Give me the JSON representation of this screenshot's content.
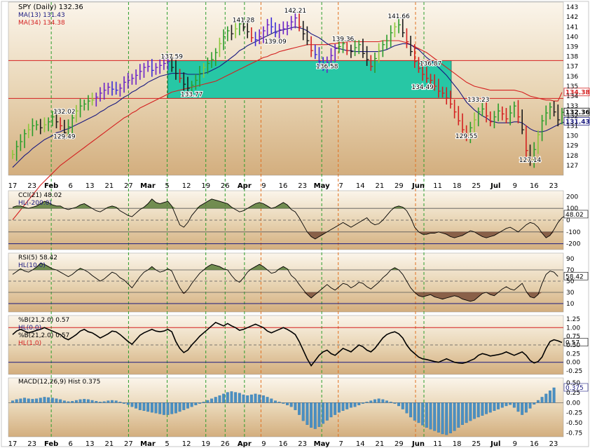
{
  "chart_data": {
    "type": "line",
    "dates": [
      "17",
      "23",
      "Feb",
      "6",
      "13",
      "21",
      "27",
      "Mar",
      "5",
      "12",
      "19",
      "26",
      "Apr",
      "9",
      "16",
      "23",
      "May",
      "7",
      "14",
      "21",
      "29",
      "Jun",
      "11",
      "18",
      "25",
      "Jul",
      "9",
      "16",
      "23"
    ],
    "main": {
      "title": "SPY (Daily) 132.36",
      "legend": [
        {
          "label": "MA(13) 131.43",
          "color": "#1a1a80"
        },
        {
          "label": "MA(34) 134.38",
          "color": "#d42020"
        }
      ],
      "yticks": [
        127,
        128,
        129,
        130,
        131,
        132,
        133,
        134,
        135,
        136,
        137,
        138,
        139,
        140,
        141,
        142,
        143
      ],
      "ylim": [
        126,
        143.5
      ],
      "annotations": [
        {
          "text": "132.02",
          "x": 13,
          "y": 132.02
        },
        {
          "text": "129.49",
          "x": 13,
          "y": 129.49
        },
        {
          "text": "137.59",
          "x": 40,
          "y": 137.59
        },
        {
          "text": "133.77",
          "x": 45,
          "y": 133.77
        },
        {
          "text": "141.28",
          "x": 58,
          "y": 141.28
        },
        {
          "text": "139.09",
          "x": 66,
          "y": 139.09
        },
        {
          "text": "142.21",
          "x": 71,
          "y": 142.21
        },
        {
          "text": "139.36",
          "x": 83,
          "y": 139.36
        },
        {
          "text": "136.58",
          "x": 79,
          "y": 136.58
        },
        {
          "text": "141.66",
          "x": 97,
          "y": 141.66
        },
        {
          "text": "136.87",
          "x": 105,
          "y": 136.87
        },
        {
          "text": "134.49",
          "x": 103,
          "y": 134.49
        },
        {
          "text": "133.23",
          "x": 117,
          "y": 133.23
        },
        {
          "text": "129.55",
          "x": 114,
          "y": 129.55
        },
        {
          "text": "127.14",
          "x": 130,
          "y": 127.14
        }
      ],
      "price_labels": [
        {
          "text": "134.38",
          "y": 134.38,
          "color": "#d42020"
        },
        {
          "text": "132.36",
          "y": 132.36,
          "color": "#000000"
        },
        {
          "text": "131.43",
          "y": 131.43,
          "color": "#1a1a80"
        }
      ],
      "zone": [
        133.77,
        137.59
      ],
      "closes": [
        128.1,
        128.9,
        129.4,
        130.2,
        130.6,
        131.0,
        131.1,
        130.8,
        131.1,
        131.4,
        131.9,
        131.4,
        131.0,
        130.3,
        130.9,
        131.8,
        132.5,
        133.0,
        133.2,
        133.5,
        133.6,
        133.9,
        134.3,
        134.6,
        134.9,
        134.7,
        134.6,
        134.8,
        135.4,
        135.6,
        135.8,
        136.1,
        136.5,
        136.9,
        137.0,
        136.6,
        136.9,
        137.1,
        137.3,
        137.5,
        136.9,
        136.3,
        135.8,
        135.2,
        134.8,
        135.1,
        135.6,
        136.3,
        136.9,
        137.3,
        137.7,
        138.4,
        139.3,
        140.0,
        140.6,
        140.3,
        140.8,
        141.3,
        141.0,
        140.5,
        139.9,
        139.7,
        140.0,
        140.6,
        141.2,
        141.0,
        140.4,
        140.7,
        140.8,
        141.1,
        141.5,
        141.9,
        141.0,
        140.3,
        139.6,
        138.6,
        138.2,
        137.5,
        137.0,
        137.4,
        138.1,
        138.8,
        139.0,
        139.3,
        138.6,
        138.5,
        138.9,
        139.2,
        138.3,
        137.7,
        137.0,
        137.8,
        138.6,
        139.2,
        139.6,
        140.4,
        141.0,
        141.2,
        140.4,
        139.5,
        138.5,
        137.5,
        136.8,
        136.2,
        135.8,
        135.6,
        135.0,
        134.5,
        134.3,
        133.8,
        133.2,
        132.4,
        131.5,
        130.6,
        129.9,
        130.8,
        131.6,
        132.4,
        132.7,
        132.0,
        131.4,
        131.9,
        132.5,
        132.2,
        131.7,
        132.3,
        133.0,
        131.9,
        130.6,
        128.5,
        127.4,
        128.6,
        130.1,
        131.5,
        132.3,
        132.9,
        132.4,
        131.6,
        132.36
      ],
      "ma13": [
        126.8,
        127.2,
        127.6,
        128.0,
        128.3,
        128.7,
        129.0,
        129.3,
        129.6,
        129.8,
        130.0,
        130.3,
        130.4,
        130.6,
        130.7,
        130.9,
        131.1,
        131.3,
        131.5,
        131.7,
        131.9,
        132.1,
        132.4,
        132.6,
        132.9,
        133.1,
        133.3,
        133.6,
        133.9,
        134.1,
        134.4,
        134.6,
        134.9,
        135.1,
        135.4,
        135.6,
        135.8,
        136.0,
        136.1,
        136.2,
        136.3,
        136.3,
        136.3,
        136.3,
        136.2,
        136.2,
        136.2,
        136.2,
        136.3,
        136.4,
        136.6,
        136.8,
        137.0,
        137.3,
        137.6,
        137.9,
        138.2,
        138.6,
        138.8,
        139.1,
        139.3,
        139.5,
        139.7,
        139.9,
        140.1,
        140.3,
        140.5,
        140.6,
        140.7,
        140.8,
        140.9,
        141.0,
        140.9,
        140.8,
        140.6,
        140.3,
        140.1,
        139.9,
        139.6,
        139.3,
        139.1,
        138.9,
        138.8,
        138.7,
        138.6,
        138.6,
        138.5,
        138.5,
        138.5,
        138.5,
        138.5,
        138.5,
        138.5,
        138.6,
        138.7,
        138.9,
        139.1,
        139.2,
        139.3,
        139.3,
        139.2,
        138.9,
        138.7,
        138.3,
        137.9,
        137.6,
        137.3,
        136.9,
        136.5,
        136.1,
        135.6,
        135.1,
        134.6,
        134.0,
        133.4,
        133.0,
        132.6,
        132.3,
        132.0,
        131.8,
        131.5,
        131.4,
        131.3,
        131.3,
        131.3,
        131.3,
        131.4,
        131.4,
        131.3,
        131.0,
        130.7,
        130.5,
        130.4,
        130.4,
        130.5,
        130.7,
        130.9,
        131.1,
        131.3,
        131.43
      ],
      "ma34": [
        121.5,
        122.0,
        122.5,
        123.0,
        123.5,
        124.0,
        124.5,
        125.0,
        125.4,
        125.8,
        126.2,
        126.6,
        127.0,
        127.3,
        127.6,
        127.9,
        128.2,
        128.5,
        128.8,
        129.1,
        129.4,
        129.7,
        130.0,
        130.3,
        130.6,
        130.9,
        131.2,
        131.5,
        131.8,
        132.0,
        132.3,
        132.5,
        132.8,
        133.0,
        133.2,
        133.4,
        133.6,
        133.8,
        134.0,
        134.2,
        134.4,
        134.5,
        134.6,
        134.7,
        134.8,
        134.9,
        135.0,
        135.1,
        135.2,
        135.3,
        135.4,
        135.5,
        135.7,
        135.9,
        136.1,
        136.3,
        136.5,
        136.7,
        136.9,
        137.1,
        137.3,
        137.5,
        137.7,
        137.9,
        138.0,
        138.2,
        138.3,
        138.5,
        138.6,
        138.7,
        138.8,
        138.9,
        139.0,
        139.1,
        139.2,
        139.2,
        139.2,
        139.2,
        139.2,
        139.2,
        139.3,
        139.3,
        139.4,
        139.4,
        139.5,
        139.5,
        139.5,
        139.5,
        139.5,
        139.5,
        139.5,
        139.5,
        139.5,
        139.6,
        139.6,
        139.6,
        139.6,
        139.6,
        139.5,
        139.4,
        139.2,
        139.0,
        138.8,
        138.6,
        138.4,
        138.1,
        137.8,
        137.5,
        137.2,
        136.9,
        136.6,
        136.3,
        136.0,
        135.7,
        135.4,
        135.2,
        135.0,
        134.9,
        134.8,
        134.7,
        134.6,
        134.6,
        134.6,
        134.6,
        134.6,
        134.6,
        134.6,
        134.5,
        134.4,
        134.2,
        134.0,
        133.9,
        133.8,
        133.7,
        133.6,
        133.6,
        133.5,
        133.5,
        134.38
      ]
    },
    "cci": {
      "title": "CCI(21) 48.02",
      "legend": "HL(-200.0)",
      "yticks": [
        "200",
        "100",
        "0",
        "-100",
        "-200"
      ],
      "ylim": [
        -250,
        250
      ],
      "current": "48.02",
      "values": [
        110,
        120,
        120,
        110,
        100,
        110,
        120,
        140,
        160,
        150,
        130,
        120,
        120,
        100,
        90,
        100,
        110,
        130,
        140,
        120,
        100,
        80,
        70,
        90,
        110,
        120,
        110,
        80,
        60,
        40,
        30,
        60,
        90,
        110,
        140,
        180,
        150,
        140,
        150,
        160,
        120,
        40,
        -40,
        -60,
        -20,
        40,
        80,
        120,
        140,
        160,
        180,
        170,
        160,
        150,
        140,
        110,
        90,
        70,
        80,
        100,
        120,
        140,
        150,
        140,
        120,
        100,
        110,
        130,
        150,
        130,
        90,
        70,
        20,
        -40,
        -100,
        -140,
        -160,
        -140,
        -120,
        -100,
        -80,
        -60,
        -40,
        -20,
        -40,
        -60,
        -40,
        -20,
        0,
        20,
        -20,
        -40,
        -30,
        0,
        40,
        80,
        110,
        120,
        110,
        80,
        20,
        -60,
        -100,
        -120,
        -120,
        -110,
        -110,
        -100,
        -110,
        -120,
        -140,
        -150,
        -140,
        -130,
        -110,
        -90,
        -100,
        -120,
        -140,
        -150,
        -140,
        -130,
        -110,
        -90,
        -70,
        -60,
        -80,
        -100,
        -70,
        -40,
        -20,
        -30,
        -60,
        -110,
        -150,
        -130,
        -80,
        -20,
        20,
        40,
        30,
        48.02
      ]
    },
    "rsi": {
      "title": "RSI(5) 58.42",
      "legend": "HL(10.0)",
      "yticks": [
        "90",
        "70",
        "50",
        "30",
        "10"
      ],
      "ylim": [
        -5,
        100
      ],
      "current": "58.42",
      "values": [
        62,
        67,
        72,
        68,
        66,
        70,
        75,
        82,
        80,
        76,
        72,
        70,
        66,
        62,
        58,
        62,
        68,
        73,
        70,
        66,
        60,
        55,
        50,
        54,
        60,
        66,
        63,
        56,
        52,
        45,
        38,
        48,
        58,
        66,
        70,
        76,
        70,
        66,
        68,
        72,
        68,
        52,
        38,
        28,
        35,
        46,
        55,
        64,
        70,
        76,
        80,
        78,
        76,
        72,
        70,
        60,
        52,
        48,
        56,
        66,
        72,
        76,
        80,
        76,
        70,
        64,
        66,
        72,
        76,
        72,
        60,
        54,
        44,
        35,
        26,
        20,
        26,
        32,
        38,
        44,
        38,
        34,
        40,
        46,
        44,
        38,
        42,
        48,
        46,
        40,
        36,
        42,
        48,
        56,
        62,
        70,
        74,
        70,
        62,
        50,
        38,
        30,
        24,
        22,
        24,
        26,
        22,
        20,
        18,
        20,
        22,
        24,
        22,
        18,
        16,
        14,
        16,
        22,
        28,
        30,
        26,
        24,
        30,
        36,
        40,
        36,
        34,
        40,
        46,
        32,
        22,
        20,
        26,
        46,
        62,
        68,
        66,
        58.42
      ]
    },
    "pctb": {
      "title": "%B(21,2.0) 0.57",
      "legend1": "HL(0.0)",
      "legend2": "%B(21,2.0) 0.57",
      "legend3": "HL(1.0)",
      "yticks": [
        "1.25",
        "1.00",
        "0.75",
        "0.50",
        "0.25",
        "0.00",
        "-0.25"
      ],
      "ylim": [
        -0.35,
        1.35
      ],
      "current": "0.57",
      "values": [
        0.8,
        0.9,
        0.95,
        0.9,
        0.85,
        0.88,
        0.92,
        0.95,
        1.0,
        0.95,
        0.9,
        0.85,
        0.8,
        0.7,
        0.65,
        0.72,
        0.8,
        0.9,
        0.95,
        0.88,
        0.85,
        0.78,
        0.7,
        0.76,
        0.82,
        0.9,
        0.88,
        0.8,
        0.7,
        0.6,
        0.52,
        0.65,
        0.78,
        0.85,
        0.9,
        0.95,
        0.9,
        0.88,
        0.9,
        0.95,
        0.88,
        0.6,
        0.4,
        0.28,
        0.35,
        0.5,
        0.62,
        0.75,
        0.85,
        0.95,
        1.05,
        1.15,
        1.1,
        1.05,
        1.12,
        1.05,
        1.0,
        0.92,
        0.95,
        1.0,
        1.05,
        1.1,
        1.05,
        1.0,
        0.9,
        0.85,
        0.9,
        0.95,
        1.0,
        0.95,
        0.88,
        0.8,
        0.6,
        0.35,
        0.1,
        -0.1,
        0.05,
        0.2,
        0.3,
        0.35,
        0.25,
        0.2,
        0.3,
        0.4,
        0.35,
        0.3,
        0.4,
        0.5,
        0.45,
        0.35,
        0.3,
        0.4,
        0.55,
        0.7,
        0.8,
        0.85,
        0.88,
        0.82,
        0.7,
        0.5,
        0.35,
        0.25,
        0.15,
        0.1,
        0.08,
        0.05,
        0.02,
        0.0,
        0.05,
        0.1,
        0.05,
        0.0,
        -0.02,
        -0.03,
        0.0,
        0.05,
        0.1,
        0.2,
        0.25,
        0.22,
        0.18,
        0.2,
        0.22,
        0.25,
        0.3,
        0.25,
        0.2,
        0.25,
        0.3,
        0.2,
        0.05,
        -0.02,
        0.02,
        0.15,
        0.4,
        0.6,
        0.65,
        0.62,
        0.57
      ]
    },
    "macd": {
      "title": "MACD(12,26,9) Hist 0.375",
      "yticks": [
        "0.50",
        "0.25",
        "0.00",
        "-0.25",
        "-0.50",
        "-0.75"
      ],
      "ylim": [
        -0.85,
        0.62
      ],
      "current": "0.375",
      "values": [
        0.05,
        0.08,
        0.1,
        0.12,
        0.1,
        0.09,
        0.1,
        0.12,
        0.14,
        0.13,
        0.12,
        0.1,
        0.08,
        0.05,
        0.03,
        0.04,
        0.06,
        0.08,
        0.09,
        0.08,
        0.06,
        0.04,
        0.02,
        0.03,
        0.05,
        0.06,
        0.05,
        0.02,
        -0.02,
        -0.05,
        -0.1,
        -0.14,
        -0.18,
        -0.2,
        -0.22,
        -0.24,
        -0.26,
        -0.28,
        -0.3,
        -0.3,
        -0.28,
        -0.26,
        -0.22,
        -0.18,
        -0.14,
        -0.1,
        -0.06,
        -0.02,
        0.02,
        0.06,
        0.1,
        0.14,
        0.18,
        0.22,
        0.26,
        0.28,
        0.26,
        0.24,
        0.2,
        0.18,
        0.2,
        0.22,
        0.2,
        0.18,
        0.14,
        0.1,
        0.05,
        0.02,
        -0.02,
        -0.06,
        -0.1,
        -0.18,
        -0.3,
        -0.45,
        -0.55,
        -0.62,
        -0.65,
        -0.6,
        -0.52,
        -0.44,
        -0.36,
        -0.3,
        -0.24,
        -0.2,
        -0.16,
        -0.12,
        -0.1,
        -0.06,
        -0.02,
        0.02,
        0.05,
        0.08,
        0.1,
        0.08,
        0.05,
        0.02,
        -0.02,
        -0.08,
        -0.16,
        -0.26,
        -0.36,
        -0.44,
        -0.5,
        -0.56,
        -0.62,
        -0.66,
        -0.7,
        -0.74,
        -0.78,
        -0.8,
        -0.76,
        -0.7,
        -0.62,
        -0.55,
        -0.5,
        -0.45,
        -0.4,
        -0.36,
        -0.32,
        -0.28,
        -0.24,
        -0.2,
        -0.16,
        -0.12,
        -0.08,
        -0.05,
        -0.12,
        -0.22,
        -0.3,
        -0.24,
        -0.14,
        -0.04,
        0.06,
        0.14,
        0.22,
        0.3,
        0.375
      ]
    }
  }
}
